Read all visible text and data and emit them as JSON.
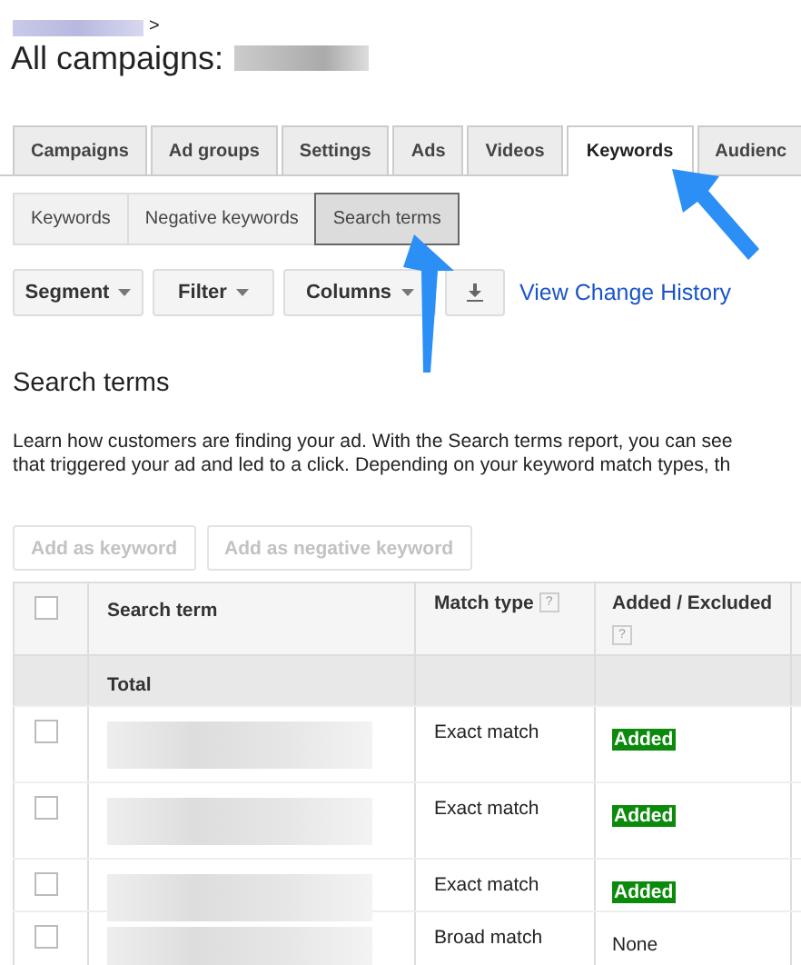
{
  "breadcrumb": {
    "separator": ">"
  },
  "title": "All campaigns:",
  "tabs": [
    {
      "label": "Campaigns",
      "selected": false
    },
    {
      "label": "Ad groups",
      "selected": false
    },
    {
      "label": "Settings",
      "selected": false
    },
    {
      "label": "Ads",
      "selected": false
    },
    {
      "label": "Videos",
      "selected": false
    },
    {
      "label": "Keywords",
      "selected": true
    },
    {
      "label": "Audienc",
      "selected": false
    }
  ],
  "subtabs": [
    {
      "label": "Keywords",
      "selected": false
    },
    {
      "label": "Negative keywords",
      "selected": false
    },
    {
      "label": "Search terms",
      "selected": true
    }
  ],
  "toolbar": {
    "buttons": [
      "Segment",
      "Filter",
      "Columns"
    ],
    "link": "View Change History"
  },
  "section_title": "Search terms",
  "description": [
    "Learn how customers are finding your ad. With the Search terms report, you can see",
    "that triggered your ad and led to a click. Depending on your keyword match types, th"
  ],
  "actions": [
    {
      "label": "Add as keyword",
      "disabled": true
    },
    {
      "label": "Add as negative keyword",
      "disabled": true
    }
  ],
  "table": {
    "select_all_checked": false,
    "help_mark": "?",
    "columns": [
      "Search term",
      "Match type",
      "Added / Excluded"
    ],
    "total_label": "Total",
    "rows": [
      {
        "checked": false,
        "match_type": "Exact match",
        "status": "Added",
        "kind": "added"
      },
      {
        "checked": false,
        "match_type": "Exact match",
        "status": "Added",
        "kind": "added"
      },
      {
        "checked": false,
        "match_type": "Exact match",
        "status": "Added",
        "kind": "added"
      },
      {
        "checked": false,
        "match_type": "Broad match",
        "status": "None",
        "kind": "none"
      }
    ]
  }
}
